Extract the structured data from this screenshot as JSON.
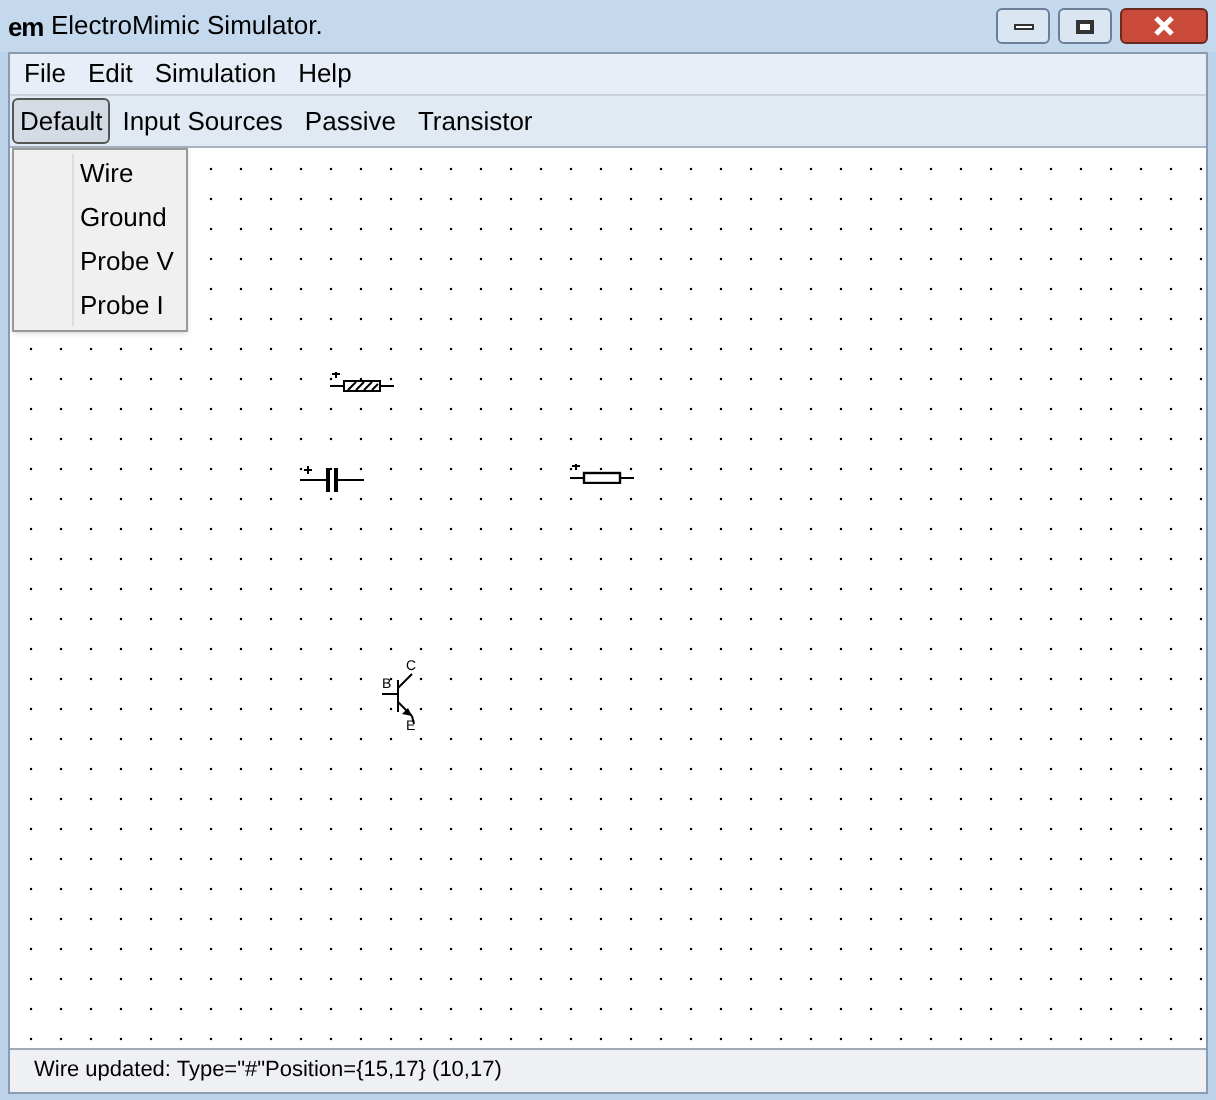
{
  "window": {
    "logo": "em",
    "title": "ElectroMimic Simulator."
  },
  "menu": [
    "File",
    "Edit",
    "Simulation",
    "Help"
  ],
  "tabs": [
    {
      "label": "Default",
      "selected": true
    },
    {
      "label": "Input Sources",
      "selected": false
    },
    {
      "label": "Passive",
      "selected": false
    },
    {
      "label": "Transistor",
      "selected": false
    }
  ],
  "dropdown": [
    "Wire",
    "Ground",
    "Probe V",
    "Probe I"
  ],
  "components": [
    {
      "kind": "resistor-hatched"
    },
    {
      "kind": "capacitor"
    },
    {
      "kind": "resistor"
    },
    {
      "kind": "transistor",
      "labels": {
        "c": "C",
        "b": "B",
        "e": "E"
      }
    }
  ],
  "status_bar": "Wire updated: Type=\"#\"Position={15,17} (10,17)"
}
